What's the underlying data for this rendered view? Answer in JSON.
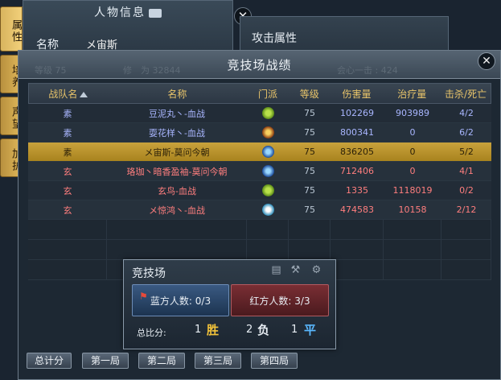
{
  "char_window": {
    "title": "人物信息",
    "name_label": "名称",
    "name_value": "メ宙斯",
    "ghost_level": "等级 75",
    "ghost_rank": "修　为 32844"
  },
  "attr_window": {
    "title": "攻击属性",
    "ghost_crit": "会心一击 : 424"
  },
  "side_tabs": [
    "属性",
    "培养",
    "声望",
    "加护"
  ],
  "arena": {
    "title": "竞技场战绩",
    "columns": [
      "战队名",
      "名称",
      "门派",
      "等级",
      "伤害量",
      "治疗量",
      "击杀/死亡"
    ],
    "rows": [
      {
        "team": "素",
        "name": "豆泥丸丶-血战",
        "school_icon": "leaf-icon",
        "level": "75",
        "damage": "102269",
        "heal": "903989",
        "kd": "4/2",
        "side": "blue",
        "selected": false
      },
      {
        "team": "素",
        "name": "耍花样丶-血战",
        "school_icon": "fire-icon",
        "level": "75",
        "damage": "800341",
        "heal": "0",
        "kd": "6/2",
        "side": "blue",
        "selected": false
      },
      {
        "team": "素",
        "name": "メ宙斯-莫问今朝",
        "school_icon": "sword-icon",
        "level": "75",
        "damage": "836205",
        "heal": "0",
        "kd": "5/2",
        "side": "blue",
        "selected": true
      },
      {
        "team": "玄",
        "name": "珞珈丶暗香盈袖-莫问今朝",
        "school_icon": "sword-icon",
        "level": "75",
        "damage": "712406",
        "heal": "0",
        "kd": "4/1",
        "side": "red",
        "selected": false
      },
      {
        "team": "玄",
        "name": "玄鸟-血战",
        "school_icon": "leaf-icon",
        "level": "75",
        "damage": "1335",
        "heal": "1118019",
        "kd": "0/2",
        "side": "red",
        "selected": false
      },
      {
        "team": "玄",
        "name": "メ惊鸿丶-血战",
        "school_icon": "yinyang-icon",
        "level": "75",
        "damage": "474583",
        "heal": "10158",
        "kd": "2/12",
        "side": "red",
        "selected": false
      }
    ]
  },
  "summary": {
    "title": "竞技场",
    "blue_text": "蓝方人数: 0/3",
    "red_text": "红方人数: 3/3",
    "score_label": "总比分:",
    "wins": "1",
    "win_mark": "胜",
    "losses": "2",
    "loss_mark": "负",
    "draws": "1",
    "draw_mark": "平",
    "colors": {
      "win": "#f2c23a",
      "loss": "#e8eef4",
      "draw": "#5ab8ff"
    }
  },
  "round_buttons": [
    "总计分",
    "第一局",
    "第二局",
    "第三局",
    "第四局"
  ]
}
